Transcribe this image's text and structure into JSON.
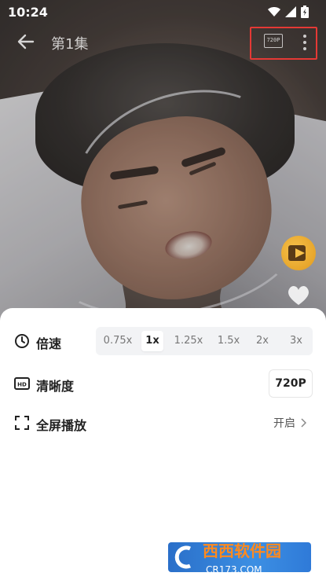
{
  "status_bar": {
    "time": "10:24"
  },
  "top_bar": {
    "episode_title": "第1集",
    "quality_icon_text": "720P"
  },
  "settings": {
    "speed": {
      "label": "倍速",
      "options": [
        "0.75x",
        "1x",
        "1.25x",
        "1.5x",
        "2x",
        "3x"
      ],
      "selected": "1x"
    },
    "quality": {
      "label": "清晰度",
      "value": "720P",
      "icon_text": "HD"
    },
    "fullscreen": {
      "label": "全屏播放",
      "value": "开启"
    }
  },
  "watermark": {
    "brand": "西西软件园",
    "domain": "CR173.COM"
  },
  "colors": {
    "highlight_box": "#e53935",
    "fab": "#f0ad2e",
    "watermark_bg": "#2f7ad8",
    "watermark_text": "#ff8a1e"
  }
}
